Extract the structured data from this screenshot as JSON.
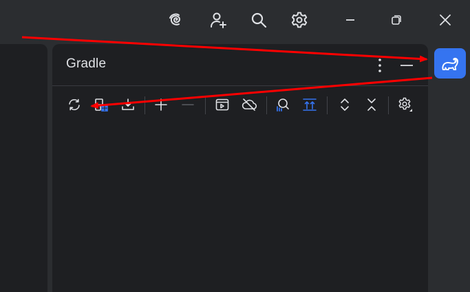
{
  "panel": {
    "title": "Gradle"
  },
  "titlebar": {
    "icons": [
      "ai-spiral-icon",
      "add-user-icon",
      "search-icon",
      "settings-gear-icon",
      "minimize-icon",
      "restore-icon",
      "close-icon"
    ]
  },
  "toolbar": {
    "icons": [
      "reload-icon",
      "link-project-icon",
      "download-sources-icon",
      "expand-plus-icon",
      "collapse-minus-icon",
      "execute-task-icon",
      "offline-mode-icon",
      "analyze-dependencies-icon",
      "show-toolwindow-icon",
      "expand-all-icon",
      "collapse-all-icon",
      "gradle-settings-icon"
    ]
  },
  "colors": {
    "accent": "#3574f0",
    "annotation_arrow": "#ff0000",
    "panel_bg": "#1e1f22",
    "frame_bg": "#2b2d30"
  }
}
